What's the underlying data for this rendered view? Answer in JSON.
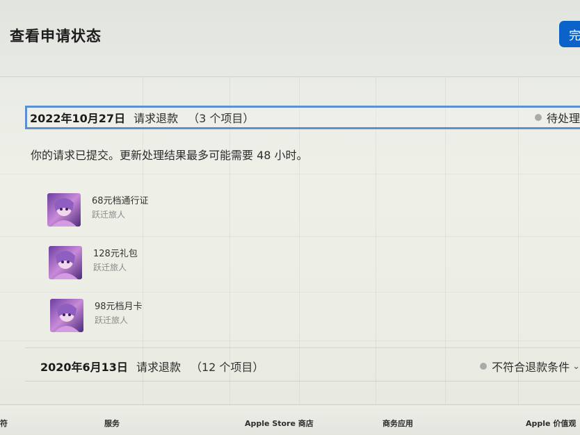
{
  "header": {
    "title": "查看申请状态",
    "done_label": "完"
  },
  "requests": [
    {
      "date": "2022年10月27日",
      "type": "请求退款",
      "count": "（3 个项目）",
      "status": "待处理",
      "notice": "你的请求已提交。更新处理结果最多可能需要 48 小时。",
      "items": [
        {
          "name": "68元档通行证",
          "developer": "跃迁旅人"
        },
        {
          "name": "128元礼包",
          "developer": "跃迁旅人"
        },
        {
          "name": "98元档月卡",
          "developer": "跃迁旅人"
        }
      ]
    },
    {
      "date": "2020年6月13日",
      "type": "请求退款",
      "count": "（12 个项目）",
      "status": "不符合退款条件"
    }
  ],
  "footer": {
    "links": [
      "符",
      "服务",
      "Apple Store 商店",
      "商务应用",
      "Apple 价值观"
    ]
  },
  "colors": {
    "accent": "#0b63c9",
    "focus_border": "#5b8fd1",
    "status_dot": "#a9abab"
  }
}
